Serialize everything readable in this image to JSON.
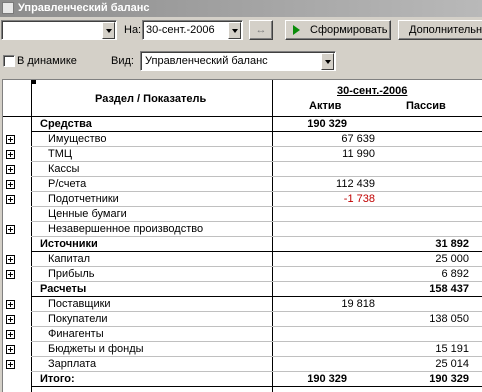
{
  "window": {
    "title": "Управленческий баланс"
  },
  "toolbar": {
    "on_label": "На:",
    "date_value": "30-сент.-2006",
    "form_button": "Сформировать",
    "extra_button": "Дополнительно"
  },
  "options": {
    "dynamics_label": "В динамике",
    "dynamics_checked": false,
    "view_label": "Вид:",
    "view_value": "Управленческий баланс"
  },
  "table": {
    "col_section": "Раздел / Показатель",
    "period": "30-сент.-2006",
    "col_active": "Актив",
    "col_passive": "Пассив",
    "rows": [
      {
        "label": "Средства",
        "active": "190 329",
        "passive": "",
        "bold": true,
        "expander": false
      },
      {
        "label": "Имущество",
        "active": "67 639",
        "passive": "",
        "bold": false,
        "expander": true
      },
      {
        "label": "ТМЦ",
        "active": "11 990",
        "passive": "",
        "bold": false,
        "expander": true
      },
      {
        "label": "Кассы",
        "active": "",
        "passive": "",
        "bold": false,
        "expander": true
      },
      {
        "label": "Р/счета",
        "active": "112 439",
        "passive": "",
        "bold": false,
        "expander": true
      },
      {
        "label": "Подотчетники",
        "active": "-1 738",
        "passive": "",
        "bold": false,
        "expander": true,
        "negative": true
      },
      {
        "label": "Ценные бумаги",
        "active": "",
        "passive": "",
        "bold": false,
        "expander": false
      },
      {
        "label": "Незавершенное производство",
        "active": "",
        "passive": "",
        "bold": false,
        "expander": true
      },
      {
        "label": "Источники",
        "active": "",
        "passive": "31 892",
        "bold": true,
        "expander": false
      },
      {
        "label": "Капитал",
        "active": "",
        "passive": "25 000",
        "bold": false,
        "expander": true
      },
      {
        "label": "Прибыль",
        "active": "",
        "passive": "6 892",
        "bold": false,
        "expander": true
      },
      {
        "label": "Расчеты",
        "active": "",
        "passive": "158 437",
        "bold": true,
        "expander": false
      },
      {
        "label": "Поставщики",
        "active": "19 818",
        "passive": "",
        "bold": false,
        "expander": true
      },
      {
        "label": "Покупатели",
        "active": "",
        "passive": "138 050",
        "bold": false,
        "expander": true
      },
      {
        "label": "Финагенты",
        "active": "",
        "passive": "",
        "bold": false,
        "expander": true
      },
      {
        "label": "Бюджеты и фонды",
        "active": "",
        "passive": "15 191",
        "bold": false,
        "expander": true
      },
      {
        "label": "Зарплата",
        "active": "",
        "passive": "25 014",
        "bold": false,
        "expander": true
      },
      {
        "label": "Итого:",
        "active": "190 329",
        "passive": "190 329",
        "bold": true,
        "expander": false
      }
    ]
  },
  "colors": {
    "negative": "#c00000",
    "title_text": "#ffffff"
  }
}
